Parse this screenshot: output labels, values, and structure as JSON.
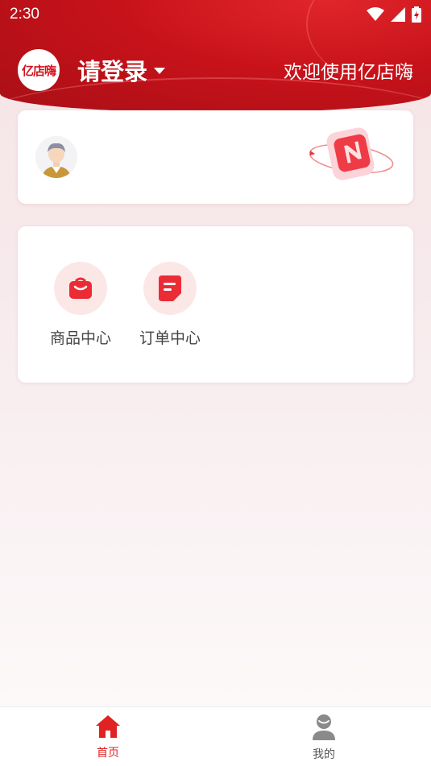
{
  "status_bar": {
    "time": "2:30",
    "icons": [
      "wifi-icon",
      "cell-signal-icon",
      "battery-charging-icon"
    ]
  },
  "header": {
    "logo_text": "亿店嗨",
    "login_label": "请登录",
    "welcome_text": "欢迎使用亿店嗨"
  },
  "menu": {
    "items": [
      {
        "label": "商品中心",
        "icon": "shopping-bag-icon"
      },
      {
        "label": "订单中心",
        "icon": "order-document-icon"
      }
    ]
  },
  "bottom_nav": {
    "items": [
      {
        "label": "首页",
        "icon": "home-icon",
        "active": true
      },
      {
        "label": "我的",
        "icon": "person-icon",
        "active": false
      }
    ]
  },
  "colors": {
    "brand_red": "#d3121b",
    "active_nav": "#e02222",
    "inactive_nav": "#8a8a8a"
  }
}
